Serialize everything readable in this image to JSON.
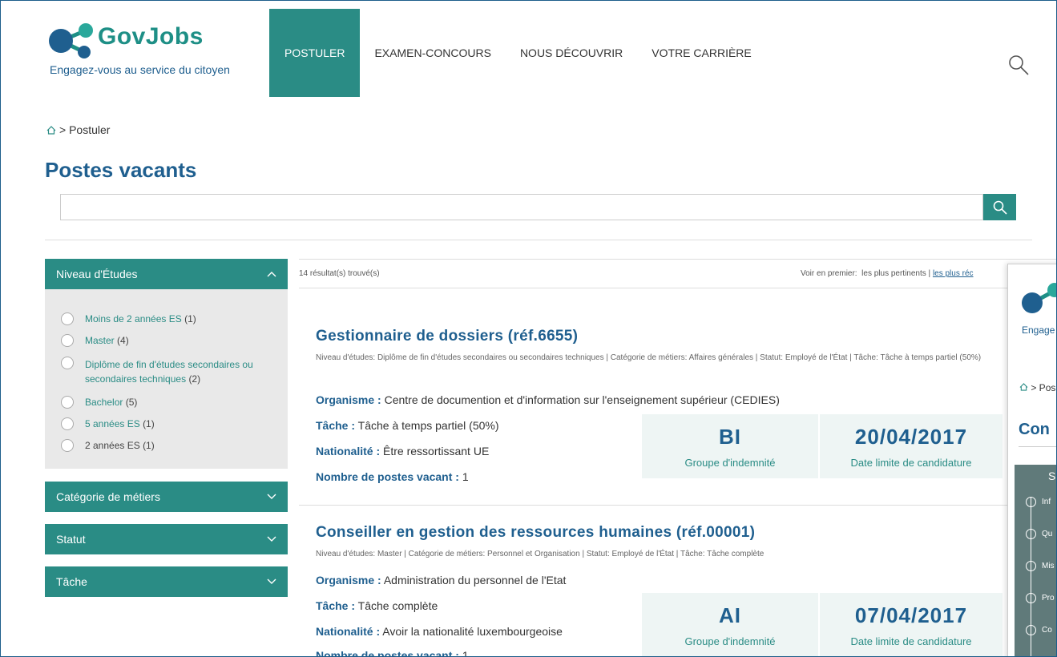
{
  "header": {
    "logo_text": "GovJobs",
    "tagline": "Engagez-vous au service du citoyen",
    "nav": [
      {
        "label": "POSTULER",
        "active": true
      },
      {
        "label": "EXAMEN-CONCOURS",
        "active": false
      },
      {
        "label": "NOUS DÉCOUVRIR",
        "active": false
      },
      {
        "label": "VOTRE CARRIÈRE",
        "active": false
      }
    ],
    "search_icon": "search-icon"
  },
  "breadcrumb": {
    "home_icon": "home-icon",
    "trail": "> Postuler"
  },
  "page_title": "Postes vacants",
  "search": {
    "value": "",
    "button_icon": "search-icon"
  },
  "filters": {
    "niveau": {
      "title": "Niveau d'Études",
      "expanded": true,
      "options": [
        {
          "label": "Moins de 2 années ES",
          "count": "(1)",
          "link": true
        },
        {
          "label": "Master",
          "count": "(4)",
          "link": true
        },
        {
          "label": "Diplôme de fin d'études secondaires ou",
          "label2": "secondaires techniques",
          "count": "(2)",
          "link": true
        },
        {
          "label": "Bachelor",
          "count": "(5)",
          "link": true
        },
        {
          "label": "5 années ES",
          "count": "(1)",
          "link": true
        },
        {
          "label": "2 années ES",
          "count": "(1)",
          "link": false
        }
      ]
    },
    "categorie": {
      "title": "Catégorie de métiers",
      "expanded": false
    },
    "statut": {
      "title": "Statut",
      "expanded": false
    },
    "tache": {
      "title": "Tâche",
      "expanded": false
    }
  },
  "results": {
    "count_text": "14 résultat(s) trouvé(s)",
    "sort_prefix": "Voir en premier:",
    "sort_relevant": "les plus pertinents",
    "sort_sep": "|",
    "sort_recent": "les plus réc"
  },
  "jobs": [
    {
      "title": "Gestionnaire de dossiers (réf.6655)",
      "meta": "Niveau d'études: Diplôme de fin d'études secondaires ou secondaires techniques  |  Catégorie de métiers: Affaires générales  |  Statut: Employé de l'État  |  Tâche: Tâche à temps partiel (50%)",
      "organisme_label": "Organisme :",
      "organisme": "Centre de documention et d'information sur l'enseignement supérieur (CEDIES)",
      "tache_label": "Tâche :",
      "tache": "Tâche à temps partiel (50%)",
      "nationalite_label": "Nationalité :",
      "nationalite": "Être ressortissant UE",
      "postes_label": "Nombre de postes vacant :",
      "postes": "1",
      "groupe": "BI",
      "groupe_label": "Groupe d'indemnité",
      "date": "20/04/2017",
      "date_label": "Date limite de candidature"
    },
    {
      "title": "Conseiller en gestion des ressources humaines (réf.00001)",
      "meta": "Niveau d'études: Master  |  Catégorie de métiers: Personnel et Organisation  |  Statut: Employé de l'État  |  Tâche: Tâche complète",
      "organisme_label": "Organisme :",
      "organisme": "Administration du personnel de l'Etat",
      "tache_label": "Tâche :",
      "tache": "Tâche complète",
      "nationalite_label": "Nationalité :",
      "nationalite": "Avoir la nationalité luxembourgeoise",
      "postes_label": "Nombre de postes vacant :",
      "postes": "1",
      "groupe": "AI",
      "groupe_label": "Groupe d'indemnité",
      "date": "07/04/2017",
      "date_label": "Date limite de candidature"
    }
  ],
  "overlay": {
    "engage": "Engage",
    "breadcrumb": "> Pos",
    "title": "Con",
    "box_title": "S",
    "steps": [
      "Inf",
      "Qu",
      "Mis",
      "Pro",
      "Co"
    ]
  },
  "colors": {
    "teal": "#2a8c85",
    "navy": "#1f5f8f"
  }
}
